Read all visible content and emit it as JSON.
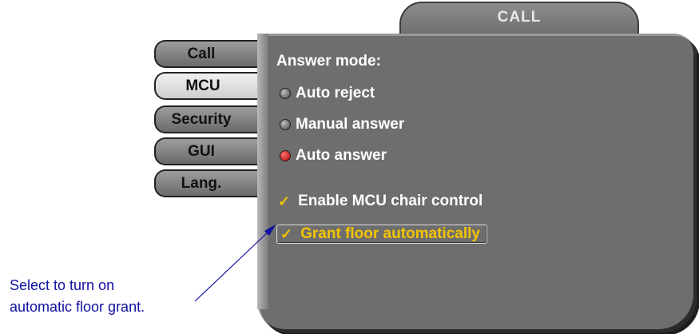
{
  "window": {
    "title": "CALL"
  },
  "tabs": [
    {
      "label": "Call",
      "active": false
    },
    {
      "label": "MCU",
      "active": true
    },
    {
      "label": "Security",
      "active": false
    },
    {
      "label": "GUI",
      "active": false
    },
    {
      "label": "Lang.",
      "active": false
    }
  ],
  "answer_mode": {
    "heading": "Answer mode:",
    "options": [
      {
        "label": "Auto reject",
        "selected": false
      },
      {
        "label": "Manual answer",
        "selected": false
      },
      {
        "label": "Auto answer",
        "selected": true
      }
    ]
  },
  "checkboxes": [
    {
      "label": "Enable MCU chair control",
      "checked": true
    },
    {
      "label": "Grant floor automatically",
      "checked": true,
      "focused": true
    }
  ],
  "callout": {
    "line1": "Select to turn on",
    "line2": "automatic floor grant."
  },
  "colors": {
    "panel": "#6e6e6e",
    "selected_radio": "#cc0000",
    "check_accent": "#f3c400",
    "callout_text": "#1010a0"
  }
}
